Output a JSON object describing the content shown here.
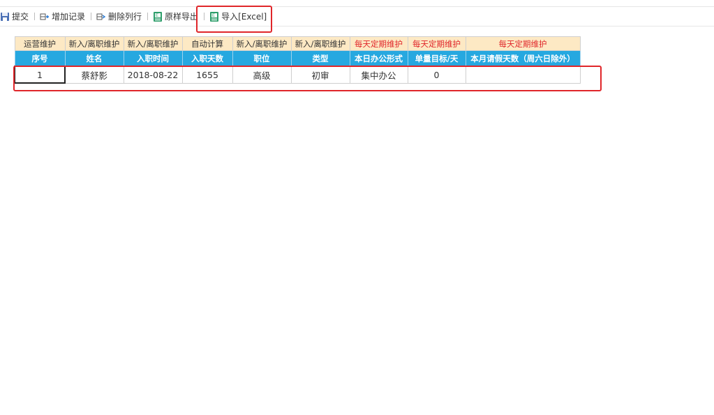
{
  "toolbar": {
    "items": [
      {
        "label": "提交",
        "icon": "save-icon"
      },
      {
        "label": "增加记录",
        "icon": "add-row-icon"
      },
      {
        "label": "删除列行",
        "icon": "delete-row-icon"
      },
      {
        "label": "原样导出",
        "icon": "excel-export-icon"
      },
      {
        "label": "导入[Excel]",
        "icon": "excel-import-icon"
      }
    ]
  },
  "colors": {
    "header_bg": "#26a8e0",
    "category_bg": "#fde9c4",
    "category_red": "#e0262a",
    "highlight_border": "#e0262a"
  },
  "table": {
    "categories": [
      "运营维护",
      "新入/离职维护",
      "新入/离职维护",
      "自动计算",
      "新入/离职维护",
      "新入/离职维护",
      "每天定期维护",
      "每天定期维护",
      "每天定期维护"
    ],
    "headers": [
      "序号",
      "姓名",
      "入职时间",
      "入职天数",
      "职位",
      "类型",
      "本日办公形式",
      "单量目标/天",
      "本月请假天数（周六日除外）"
    ],
    "rows": [
      [
        "1",
        "蔡舒影",
        "2018-08-22",
        "1655",
        "高级",
        "初审",
        "集中办公",
        "0",
        ""
      ]
    ]
  }
}
